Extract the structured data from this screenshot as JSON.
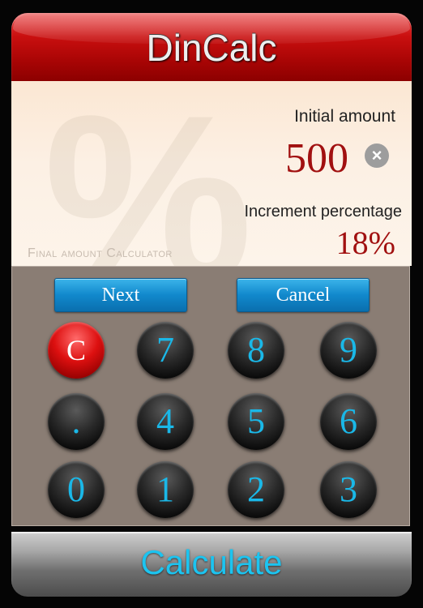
{
  "app": {
    "title": "DinCalc"
  },
  "display": {
    "watermark_symbol": "%",
    "calculator_name": "Final amount Calculator",
    "initial_label": "Initial amount",
    "initial_value": "500",
    "clear_symbol": "×",
    "increment_label": "Increment percentage",
    "increment_value": "18%"
  },
  "actions": {
    "next_label": "Next",
    "cancel_label": "Cancel"
  },
  "keys": {
    "clear": "C",
    "k7": "7",
    "k8": "8",
    "k9": "9",
    "dot": ".",
    "k4": "4",
    "k5": "5",
    "k6": "6",
    "k0": "0",
    "k1": "1",
    "k2": "2",
    "k3": "3"
  },
  "footer": {
    "calculate_label": "Calculate"
  },
  "colors": {
    "title_red": "#c90f0f",
    "value_red": "#a11010",
    "accent_cyan": "#1ab8e8",
    "button_blue": "#1188cc"
  }
}
